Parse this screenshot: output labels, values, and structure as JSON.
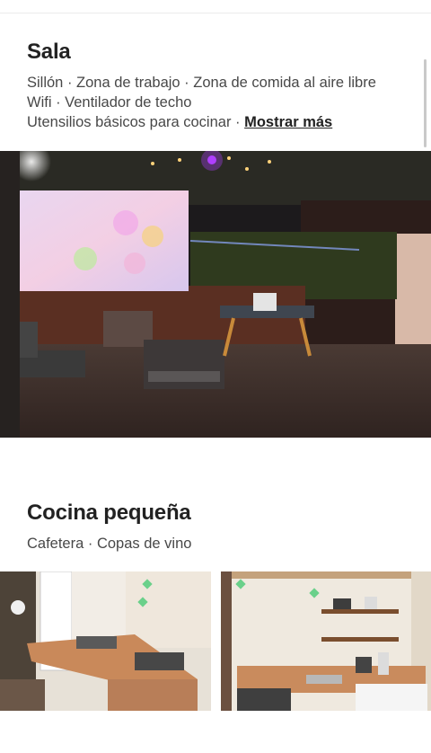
{
  "sections": [
    {
      "title": "Sala",
      "amenities_lines": [
        "Sillón · Zona de trabajo · Zona de comida al aire libre",
        "Wifi · Ventilador de techo",
        "Utensilios básicos para cocinar · "
      ],
      "show_more_label": "Mostrar más",
      "photo": "living-room-patio-photo"
    },
    {
      "title": "Cocina pequeña",
      "amenities_lines": [
        "Cafetera · Copas de vino"
      ],
      "photos": [
        "kitchen-counter-photo",
        "kitchen-stove-photo"
      ]
    }
  ]
}
